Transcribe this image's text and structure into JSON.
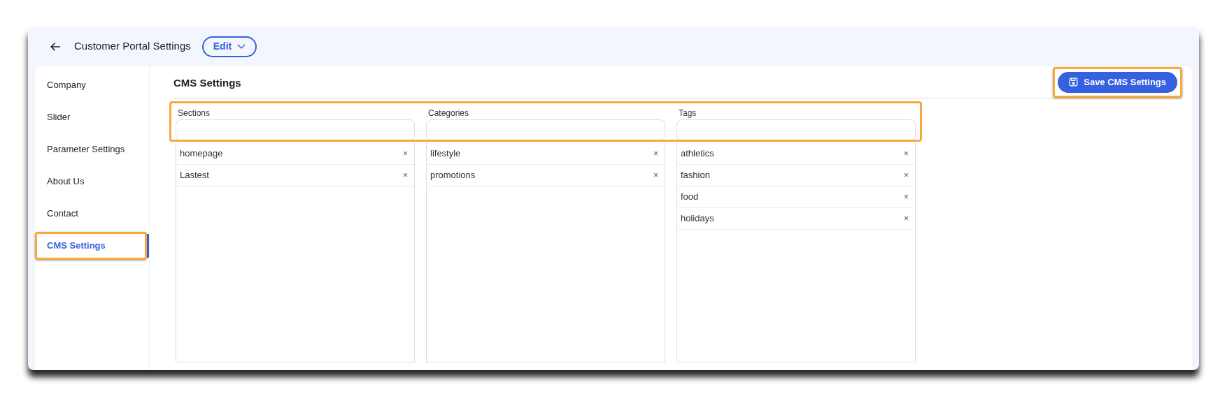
{
  "header": {
    "title": "Customer Portal Settings",
    "mode_button": "Edit"
  },
  "sidebar": {
    "items": [
      {
        "label": "Company",
        "selected": false,
        "highlighted": false
      },
      {
        "label": "Slider",
        "selected": false,
        "highlighted": false
      },
      {
        "label": "Parameter Settings",
        "selected": false,
        "highlighted": false
      },
      {
        "label": "About Us",
        "selected": false,
        "highlighted": false
      },
      {
        "label": "Contact",
        "selected": false,
        "highlighted": false
      },
      {
        "label": "CMS Settings",
        "selected": true,
        "highlighted": true
      }
    ]
  },
  "main": {
    "title": "CMS Settings",
    "save_button": {
      "label": "Save CMS Settings",
      "highlighted": true
    },
    "fields_highlighted": true,
    "lists": [
      {
        "label": "Sections",
        "items": [
          "homepage",
          "Lastest"
        ]
      },
      {
        "label": "Categories",
        "items": [
          "lifestyle",
          "promotions"
        ]
      },
      {
        "label": "Tags",
        "items": [
          "athletics",
          "fashion",
          "food",
          "holidays"
        ]
      }
    ]
  },
  "remove_glyph": "×"
}
